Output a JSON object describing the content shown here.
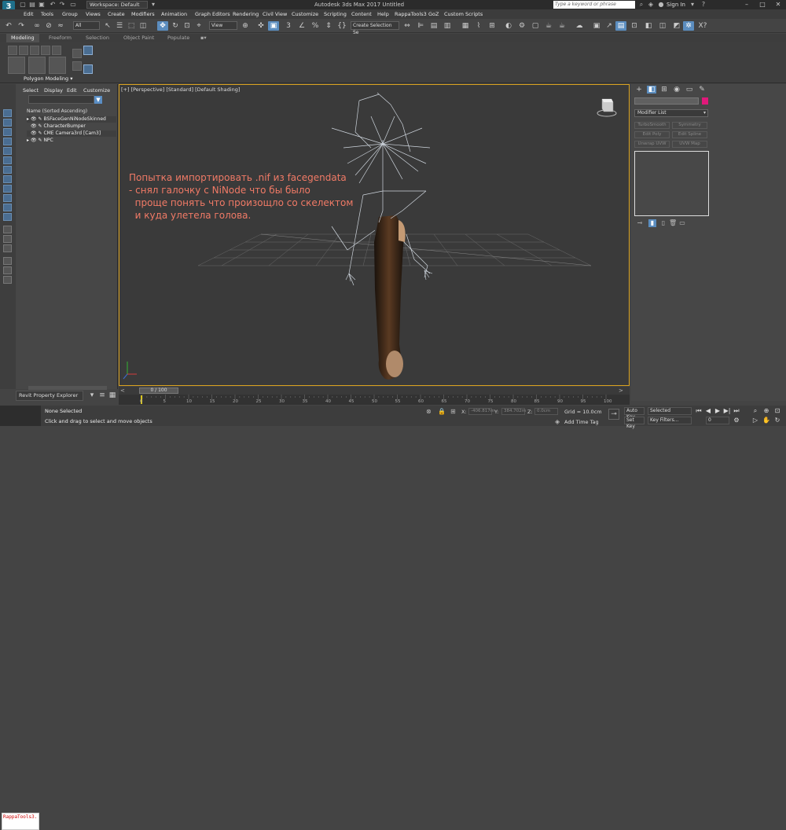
{
  "titlebar": {
    "app_logo": "3",
    "workspace_label": "Workspace: Default",
    "title": "Autodesk 3ds Max 2017     Untitled",
    "help_search_placeholder": "Type a keyword or phrase",
    "sign_in": "Sign In",
    "window_controls": [
      "–",
      "□",
      "✕"
    ]
  },
  "menubar": {
    "items": [
      "Edit",
      "Tools",
      "Group",
      "Views",
      "Create",
      "Modifiers",
      "Animation",
      "Graph Editors",
      "Rendering",
      "Civil View",
      "Customize",
      "Scripting",
      "Content",
      "Help",
      "RappaTools3",
      "GoZ",
      "Custom Scripts"
    ]
  },
  "main_toolbar": {
    "selection_filter": "All",
    "reference_coord": "View",
    "named_selection": "Create Selection Se"
  },
  "ribbon": {
    "tabs": [
      "Modeling",
      "Freeform",
      "Selection",
      "Object Paint",
      "Populate"
    ],
    "active_tab": "Modeling",
    "panel_label": "Polygon Modeling ▾"
  },
  "scene_explorer": {
    "menu": [
      "Select",
      "Display",
      "Edit",
      "Customize"
    ],
    "header": "Name (Sorted Ascending)",
    "rows": [
      "BSFaceGenNiNodeSkinned",
      "CharacterBumper",
      "CME Camera3rd [Cam3]",
      "NPC"
    ],
    "bottom_panel": "Revit Property Explorer"
  },
  "viewport": {
    "label": "[+] [Perspective] [Standard] [Default Shading]",
    "note_lines": [
      "Попытка импортировать .nif из facegendata",
      "- снял галочку с NiNode что бы было",
      "  проще понять что произощло со скелектом",
      "  и куда улетела голова."
    ],
    "colors": {
      "note": "#f07a66",
      "border": "#d9a11e",
      "wire": "#cfd6de"
    }
  },
  "timeline": {
    "frame_readout": "0 / 100",
    "ticks": [
      "0",
      "5",
      "10",
      "15",
      "20",
      "25",
      "30",
      "35",
      "40",
      "45",
      "50",
      "55",
      "60",
      "65",
      "70",
      "75",
      "80",
      "85",
      "90",
      "95",
      "100"
    ]
  },
  "command_panel": {
    "modifier_list": "Modifier List",
    "buttons": [
      "TurboSmooth",
      "Symmetry",
      "Edit Poly",
      "Edit Spline",
      "Unwrap UVW",
      "UVW Map"
    ],
    "color_swatch": "#e0197a"
  },
  "status": {
    "maxscript_line1": "RappaTools3.",
    "maxscript_line2": "",
    "selection": "None Selected",
    "hint": "Click and drag to select and move objects",
    "x_label": "X:",
    "x_value": "-406.817m",
    "y_label": "Y:",
    "y_value": "384.702m",
    "z_label": "Z:",
    "z_value": "0.0cm",
    "grid": "Grid = 10.0cm",
    "add_time_tag": "Add Time Tag",
    "auto_key": "Auto Key",
    "set_key": "Set Key",
    "selected": "Selected",
    "key_filters": "Key Filters...",
    "frame": "0"
  }
}
